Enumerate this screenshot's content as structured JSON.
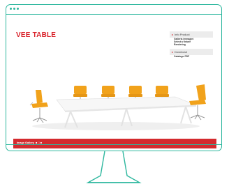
{
  "page": {
    "title": "VEE TABLE",
    "panel": {
      "info_header": "Info Product",
      "info_items": [
        "Galleria immagini",
        "Select a fixture",
        "Rendering"
      ],
      "download_header": "Download",
      "download_items": [
        "Catalogo PDF"
      ]
    },
    "footer": {
      "label": "Image Gallery",
      "pager": "■ □ ■"
    }
  },
  "colors": {
    "frame": "#2db79e",
    "accent_red": "#d9222a",
    "chair_orange": "#f1a21b"
  }
}
